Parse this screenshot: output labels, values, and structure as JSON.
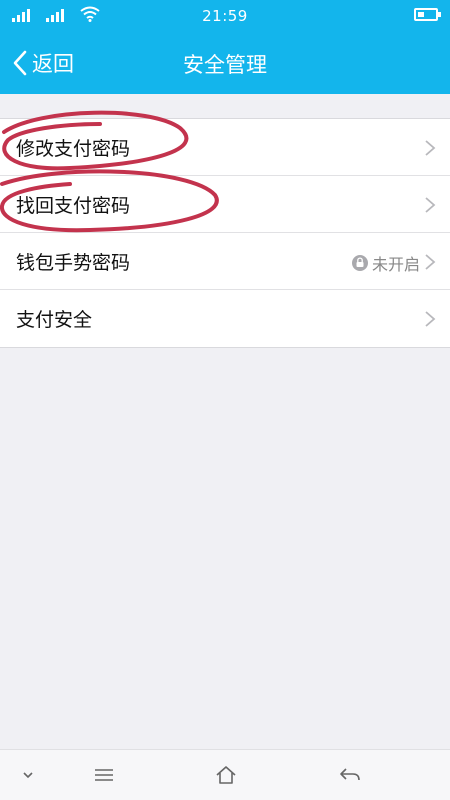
{
  "status_bar": {
    "time": "21:59"
  },
  "header": {
    "back_label": "返回",
    "title": "安全管理"
  },
  "list": {
    "items": [
      {
        "label": "修改支付密码",
        "status": ""
      },
      {
        "label": "找回支付密码",
        "status": ""
      },
      {
        "label": "钱包手势密码",
        "status": "未开启"
      },
      {
        "label": "支付安全",
        "status": ""
      }
    ]
  },
  "colors": {
    "header": "#13b5ec",
    "annotation": "#c3334d",
    "background": "#f0f0f4"
  },
  "icons": {
    "back": "chevron-left-icon",
    "row_arrow": "chevron-right-icon",
    "lock": "lock-icon",
    "nav": [
      "chevron-down-icon",
      "menu-icon",
      "home-icon",
      "back-arrow-icon"
    ]
  }
}
